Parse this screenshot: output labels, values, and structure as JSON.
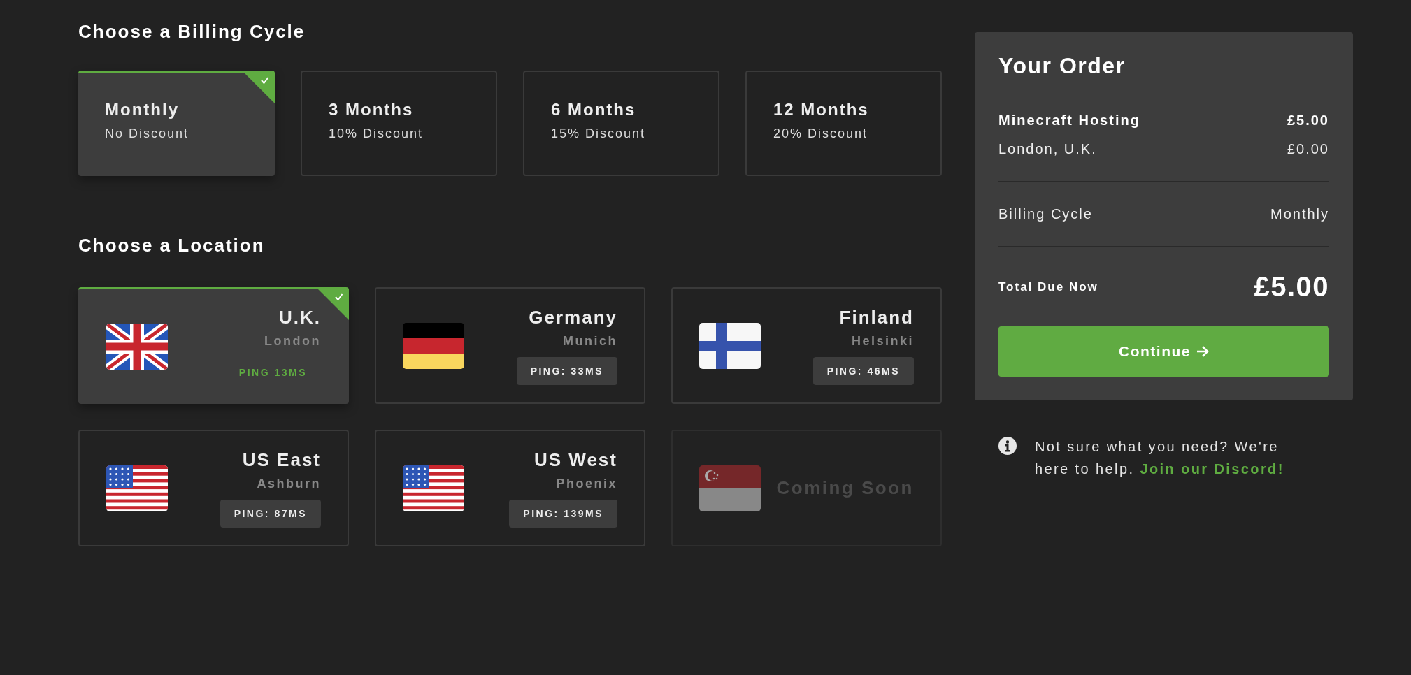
{
  "billing": {
    "heading": "Choose a Billing Cycle",
    "cycles": [
      {
        "name": "Monthly",
        "discount": "No Discount",
        "selected": true
      },
      {
        "name": "3 Months",
        "discount": "10% Discount",
        "selected": false
      },
      {
        "name": "6 Months",
        "discount": "15% Discount",
        "selected": false
      },
      {
        "name": "12 Months",
        "discount": "20% Discount",
        "selected": false
      }
    ]
  },
  "location": {
    "heading": "Choose a Location",
    "locations": [
      {
        "kind": "gb",
        "name": "U.K.",
        "city": "London",
        "ping": "PING 13MS",
        "available": true,
        "selected": true
      },
      {
        "kind": "de",
        "name": "Germany",
        "city": "Munich",
        "ping": "PING: 33MS",
        "available": true,
        "selected": false
      },
      {
        "kind": "fi",
        "name": "Finland",
        "city": "Helsinki",
        "ping": "PING: 46MS",
        "available": true,
        "selected": false
      },
      {
        "kind": "us",
        "name": "US East",
        "city": "Ashburn",
        "ping": "PING: 87MS",
        "available": true,
        "selected": false
      },
      {
        "kind": "us",
        "name": "US West",
        "city": "Phoenix",
        "ping": "PING: 139MS",
        "available": true,
        "selected": false
      },
      {
        "kind": "sg",
        "status": "Coming Soon",
        "available": false,
        "selected": false
      }
    ]
  },
  "order": {
    "title": "Your Order",
    "lines": [
      {
        "kind": "product",
        "label": "Minecraft Hosting",
        "amount": "£5.00"
      },
      {
        "kind": "addon",
        "label": "London, U.K.",
        "amount": "£0.00"
      }
    ],
    "billing": {
      "label": "Billing Cycle",
      "value": "Monthly"
    },
    "total": {
      "label": "Total Due Now",
      "amount": "£5.00"
    },
    "button": "Continue"
  },
  "help": {
    "text": "Not sure what you need? We're here to help.",
    "link": "Join our Discord!"
  }
}
